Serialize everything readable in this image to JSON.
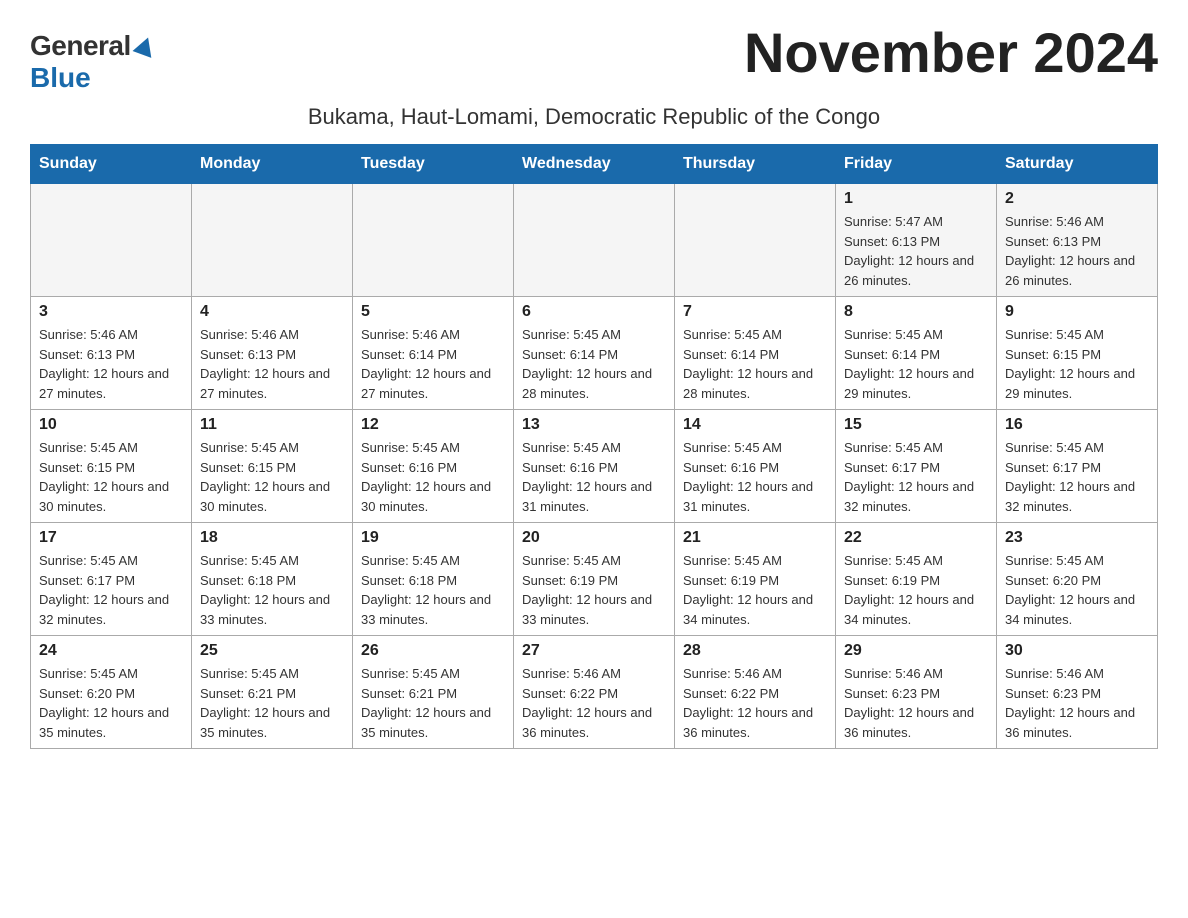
{
  "logo": {
    "general": "General",
    "blue": "Blue"
  },
  "page_title": "November 2024",
  "subtitle": "Bukama, Haut-Lomami, Democratic Republic of the Congo",
  "days_of_week": [
    "Sunday",
    "Monday",
    "Tuesday",
    "Wednesday",
    "Thursday",
    "Friday",
    "Saturday"
  ],
  "weeks": [
    [
      {
        "day": "",
        "sunrise": "",
        "sunset": "",
        "daylight": "",
        "empty": true
      },
      {
        "day": "",
        "sunrise": "",
        "sunset": "",
        "daylight": "",
        "empty": true
      },
      {
        "day": "",
        "sunrise": "",
        "sunset": "",
        "daylight": "",
        "empty": true
      },
      {
        "day": "",
        "sunrise": "",
        "sunset": "",
        "daylight": "",
        "empty": true
      },
      {
        "day": "",
        "sunrise": "",
        "sunset": "",
        "daylight": "",
        "empty": true
      },
      {
        "day": "1",
        "sunrise": "Sunrise: 5:47 AM",
        "sunset": "Sunset: 6:13 PM",
        "daylight": "Daylight: 12 hours and 26 minutes.",
        "empty": false
      },
      {
        "day": "2",
        "sunrise": "Sunrise: 5:46 AM",
        "sunset": "Sunset: 6:13 PM",
        "daylight": "Daylight: 12 hours and 26 minutes.",
        "empty": false
      }
    ],
    [
      {
        "day": "3",
        "sunrise": "Sunrise: 5:46 AM",
        "sunset": "Sunset: 6:13 PM",
        "daylight": "Daylight: 12 hours and 27 minutes.",
        "empty": false
      },
      {
        "day": "4",
        "sunrise": "Sunrise: 5:46 AM",
        "sunset": "Sunset: 6:13 PM",
        "daylight": "Daylight: 12 hours and 27 minutes.",
        "empty": false
      },
      {
        "day": "5",
        "sunrise": "Sunrise: 5:46 AM",
        "sunset": "Sunset: 6:14 PM",
        "daylight": "Daylight: 12 hours and 27 minutes.",
        "empty": false
      },
      {
        "day": "6",
        "sunrise": "Sunrise: 5:45 AM",
        "sunset": "Sunset: 6:14 PM",
        "daylight": "Daylight: 12 hours and 28 minutes.",
        "empty": false
      },
      {
        "day": "7",
        "sunrise": "Sunrise: 5:45 AM",
        "sunset": "Sunset: 6:14 PM",
        "daylight": "Daylight: 12 hours and 28 minutes.",
        "empty": false
      },
      {
        "day": "8",
        "sunrise": "Sunrise: 5:45 AM",
        "sunset": "Sunset: 6:14 PM",
        "daylight": "Daylight: 12 hours and 29 minutes.",
        "empty": false
      },
      {
        "day": "9",
        "sunrise": "Sunrise: 5:45 AM",
        "sunset": "Sunset: 6:15 PM",
        "daylight": "Daylight: 12 hours and 29 minutes.",
        "empty": false
      }
    ],
    [
      {
        "day": "10",
        "sunrise": "Sunrise: 5:45 AM",
        "sunset": "Sunset: 6:15 PM",
        "daylight": "Daylight: 12 hours and 30 minutes.",
        "empty": false
      },
      {
        "day": "11",
        "sunrise": "Sunrise: 5:45 AM",
        "sunset": "Sunset: 6:15 PM",
        "daylight": "Daylight: 12 hours and 30 minutes.",
        "empty": false
      },
      {
        "day": "12",
        "sunrise": "Sunrise: 5:45 AM",
        "sunset": "Sunset: 6:16 PM",
        "daylight": "Daylight: 12 hours and 30 minutes.",
        "empty": false
      },
      {
        "day": "13",
        "sunrise": "Sunrise: 5:45 AM",
        "sunset": "Sunset: 6:16 PM",
        "daylight": "Daylight: 12 hours and 31 minutes.",
        "empty": false
      },
      {
        "day": "14",
        "sunrise": "Sunrise: 5:45 AM",
        "sunset": "Sunset: 6:16 PM",
        "daylight": "Daylight: 12 hours and 31 minutes.",
        "empty": false
      },
      {
        "day": "15",
        "sunrise": "Sunrise: 5:45 AM",
        "sunset": "Sunset: 6:17 PM",
        "daylight": "Daylight: 12 hours and 32 minutes.",
        "empty": false
      },
      {
        "day": "16",
        "sunrise": "Sunrise: 5:45 AM",
        "sunset": "Sunset: 6:17 PM",
        "daylight": "Daylight: 12 hours and 32 minutes.",
        "empty": false
      }
    ],
    [
      {
        "day": "17",
        "sunrise": "Sunrise: 5:45 AM",
        "sunset": "Sunset: 6:17 PM",
        "daylight": "Daylight: 12 hours and 32 minutes.",
        "empty": false
      },
      {
        "day": "18",
        "sunrise": "Sunrise: 5:45 AM",
        "sunset": "Sunset: 6:18 PM",
        "daylight": "Daylight: 12 hours and 33 minutes.",
        "empty": false
      },
      {
        "day": "19",
        "sunrise": "Sunrise: 5:45 AM",
        "sunset": "Sunset: 6:18 PM",
        "daylight": "Daylight: 12 hours and 33 minutes.",
        "empty": false
      },
      {
        "day": "20",
        "sunrise": "Sunrise: 5:45 AM",
        "sunset": "Sunset: 6:19 PM",
        "daylight": "Daylight: 12 hours and 33 minutes.",
        "empty": false
      },
      {
        "day": "21",
        "sunrise": "Sunrise: 5:45 AM",
        "sunset": "Sunset: 6:19 PM",
        "daylight": "Daylight: 12 hours and 34 minutes.",
        "empty": false
      },
      {
        "day": "22",
        "sunrise": "Sunrise: 5:45 AM",
        "sunset": "Sunset: 6:19 PM",
        "daylight": "Daylight: 12 hours and 34 minutes.",
        "empty": false
      },
      {
        "day": "23",
        "sunrise": "Sunrise: 5:45 AM",
        "sunset": "Sunset: 6:20 PM",
        "daylight": "Daylight: 12 hours and 34 minutes.",
        "empty": false
      }
    ],
    [
      {
        "day": "24",
        "sunrise": "Sunrise: 5:45 AM",
        "sunset": "Sunset: 6:20 PM",
        "daylight": "Daylight: 12 hours and 35 minutes.",
        "empty": false
      },
      {
        "day": "25",
        "sunrise": "Sunrise: 5:45 AM",
        "sunset": "Sunset: 6:21 PM",
        "daylight": "Daylight: 12 hours and 35 minutes.",
        "empty": false
      },
      {
        "day": "26",
        "sunrise": "Sunrise: 5:45 AM",
        "sunset": "Sunset: 6:21 PM",
        "daylight": "Daylight: 12 hours and 35 minutes.",
        "empty": false
      },
      {
        "day": "27",
        "sunrise": "Sunrise: 5:46 AM",
        "sunset": "Sunset: 6:22 PM",
        "daylight": "Daylight: 12 hours and 36 minutes.",
        "empty": false
      },
      {
        "day": "28",
        "sunrise": "Sunrise: 5:46 AM",
        "sunset": "Sunset: 6:22 PM",
        "daylight": "Daylight: 12 hours and 36 minutes.",
        "empty": false
      },
      {
        "day": "29",
        "sunrise": "Sunrise: 5:46 AM",
        "sunset": "Sunset: 6:23 PM",
        "daylight": "Daylight: 12 hours and 36 minutes.",
        "empty": false
      },
      {
        "day": "30",
        "sunrise": "Sunrise: 5:46 AM",
        "sunset": "Sunset: 6:23 PM",
        "daylight": "Daylight: 12 hours and 36 minutes.",
        "empty": false
      }
    ]
  ]
}
